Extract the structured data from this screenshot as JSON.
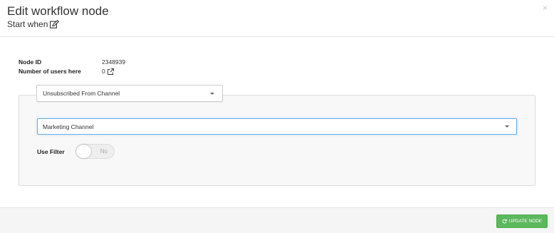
{
  "header": {
    "title": "Edit workflow node",
    "subtitle": "Start when",
    "close_glyph": "×"
  },
  "info": {
    "node_id_label": "Node ID",
    "node_id_value": "2348939",
    "users_label": "Number of users here",
    "users_value": "0"
  },
  "trigger": {
    "selected": "Unsubscribed From Channel"
  },
  "channel": {
    "selected": "Marketing Channel"
  },
  "filter": {
    "label": "Use Filter",
    "toggle_text": "No",
    "enabled": false
  },
  "footer": {
    "update_label": "UPDATE NODE"
  },
  "icons": {
    "subtitle_icon": "edit-icon",
    "users_icon": "external-link-icon",
    "update_icon": "refresh-icon",
    "dropdown_icon": "caret-down-icon"
  },
  "colors": {
    "primary_button": "#5cb85c",
    "focus_border": "#66afe9",
    "panel_bg": "#f8f8f8"
  }
}
